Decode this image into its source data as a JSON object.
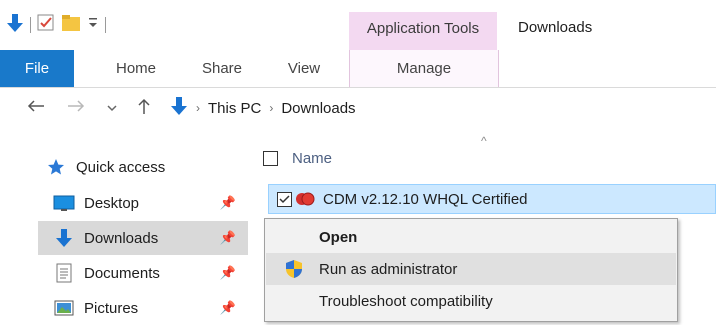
{
  "window": {
    "title": "Downloads"
  },
  "quick_access_toolbar": {
    "items": [
      {
        "icon": "down-arrow-icon"
      },
      {
        "icon": "properties-checkbox-icon"
      },
      {
        "icon": "new-folder-icon"
      },
      {
        "icon": "customize-dropdown-icon"
      }
    ]
  },
  "ribbon": {
    "context_group_label": "Application Tools",
    "tabs": [
      {
        "label": "File",
        "active": true
      },
      {
        "label": "Home"
      },
      {
        "label": "Share"
      },
      {
        "label": "View"
      },
      {
        "label": "Manage"
      }
    ],
    "colors": {
      "file_tab": "#1979ca",
      "context_group": "#f3d9f1"
    }
  },
  "address_bar": {
    "crumbs": [
      "This PC",
      "Downloads"
    ]
  },
  "nav_pane": {
    "quick_access_label": "Quick access",
    "items": [
      {
        "label": "Desktop",
        "icon": "desktop-icon",
        "pinned": true
      },
      {
        "label": "Downloads",
        "icon": "downloads-icon",
        "pinned": true,
        "selected": true
      },
      {
        "label": "Documents",
        "icon": "documents-icon",
        "pinned": true
      },
      {
        "label": "Pictures",
        "icon": "pictures-icon",
        "pinned": true
      }
    ]
  },
  "file_list": {
    "column_name": "Name",
    "sort": "ascending",
    "files": [
      {
        "name": "CDM v2.12.10 WHQL Certified",
        "checked": true,
        "selected": true,
        "icon": "cdm-setup-icon"
      }
    ]
  },
  "context_menu": {
    "items": [
      {
        "label": "Open",
        "bold": true
      },
      {
        "label": "Run as administrator",
        "icon": "uac-shield-icon",
        "hovered": true
      },
      {
        "label": "Troubleshoot compatibility"
      }
    ]
  }
}
